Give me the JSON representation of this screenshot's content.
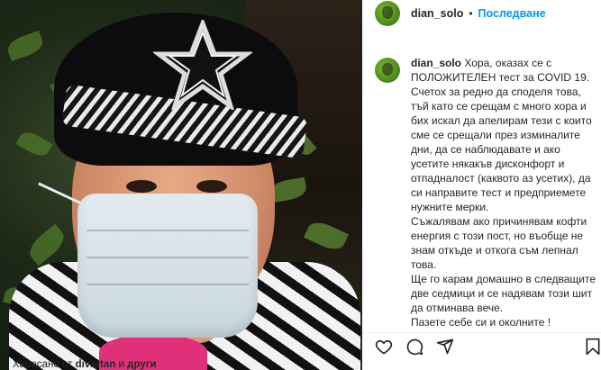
{
  "post": {
    "username": "dian_solo",
    "separator": "•",
    "follow_label": "Последване"
  },
  "caption": {
    "username": "dian_solo",
    "paragraphs": [
      "Хора, оказах се с ПОЛОЖИТЕЛЕН тест за COVID 19. Счетох за редно да споделя това, тъй като се срещам с много хора и бих искал да апелирам тези с които сме се срещали през изминалите дни, да се наблюдавате и ако усетите някакъв дисконфорт и отпадналост (каквото аз усетих), да си направите тест и предприемете нужните мерки.",
      "Съжалявам ако причинявам кофти енергия с този пост, но въобще не знам откъде и откога съм лепнал това.",
      "Ще го карам домашно в следващите две седмици и се надявам този шит да отминава вече.",
      "Пазете себе си и околните !"
    ]
  },
  "actions": {
    "like": "heart-icon",
    "comment": "comment-icon",
    "share": "share-icon",
    "save": "bookmark-icon"
  },
  "likes": {
    "prefix": "Харесано от",
    "user": "divartan",
    "and": "и",
    "others": "други"
  },
  "colors": {
    "link_blue": "#0095f6",
    "text": "#262626",
    "divider": "#efefef"
  }
}
